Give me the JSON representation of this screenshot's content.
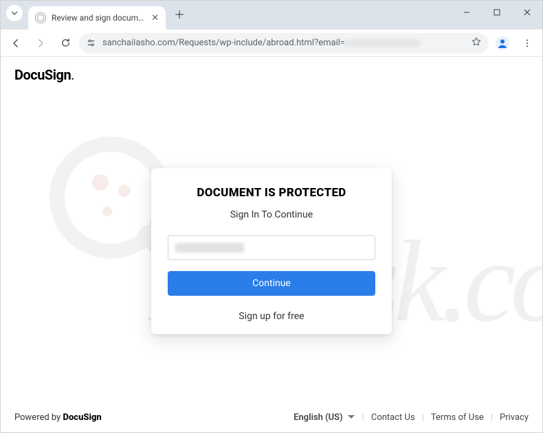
{
  "browser": {
    "tab_title": "Review and sign document(s) |",
    "url_prefix": "sanchailasho.com/Requests/wp-include/abroad.html?email="
  },
  "page": {
    "brand": "DocuSign",
    "card": {
      "heading": "DOCUMENT IS PROTECTED",
      "subheading": "Sign In To Continue",
      "continue_label": "Continue",
      "signup_label": "Sign up for free"
    },
    "footer": {
      "powered_prefix": "Powered by ",
      "powered_brand": "DocuSign",
      "language": "English (US)",
      "contact": "Contact Us",
      "terms": "Terms of Use",
      "privacy": "Privacy"
    },
    "watermark_text": "PCrisk.com"
  }
}
